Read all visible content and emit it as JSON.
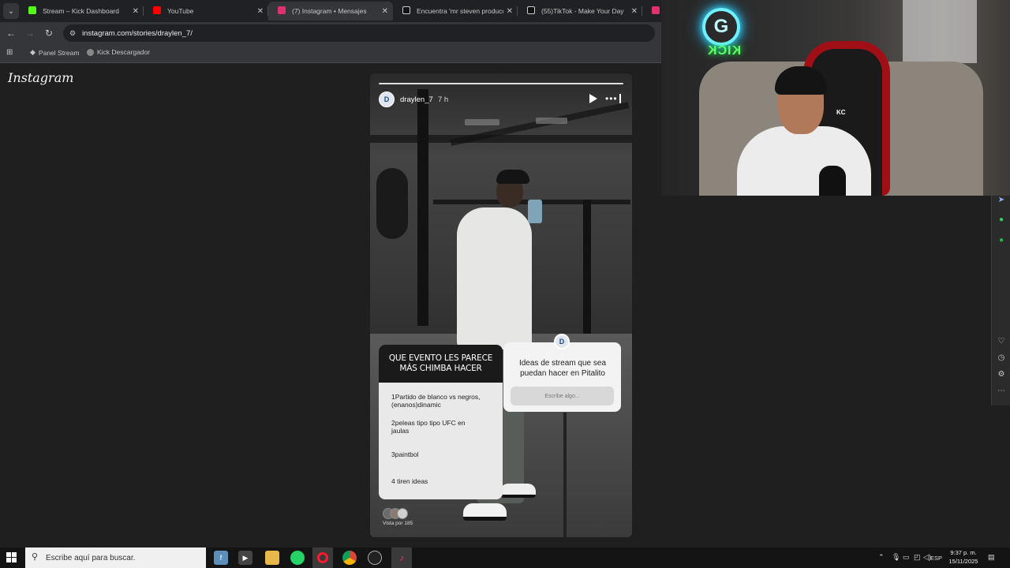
{
  "browser": {
    "tabs": [
      {
        "label": "Stream – Kick Dashboard",
        "icon": "kick-icon",
        "color": "#53fc18"
      },
      {
        "label": "YouTube",
        "icon": "youtube-icon",
        "color": "#ff0000"
      },
      {
        "label": "(7) Instagram • Mensajes",
        "icon": "instagram-icon",
        "color": "#e1306c"
      },
      {
        "label": "Encuentra 'mr steven produccio",
        "icon": "tiktok-icon",
        "color": "#ffffff"
      },
      {
        "label": "(55)TikTok - Make Your Day",
        "icon": "tiktok-icon",
        "color": "#ffffff"
      }
    ],
    "url": "instagram.com/stories/draylen_7/",
    "bookmarks": [
      {
        "label": "Panel Stream"
      },
      {
        "label": "Kick Descargador"
      }
    ]
  },
  "instagram": {
    "logo": "Instagram",
    "story": {
      "username": "draylen_7",
      "time": "7 h",
      "poll": {
        "title": "QUE EVENTO LES PARECE MÁS CHIMBA HACER",
        "options": [
          "1Partido de blanco vs negros,(enanos)dinamic",
          "2peleas tipo tipo UFC en jaulas",
          "3paintbol",
          "4 tiren ideas"
        ]
      },
      "question": {
        "text": "Ideas de stream que sea puedan hacer en Pitalito",
        "placeholder": "Escribe algo..."
      },
      "viewers_label": "Vista por 185"
    }
  },
  "webcam": {
    "badge": "KC"
  },
  "taskbar": {
    "search_placeholder": "Escribe aquí para buscar.",
    "language": "ESP",
    "time": "9:37 p. m.",
    "date": "15/11/2025"
  },
  "colors": {
    "kick_green": "#53fc18",
    "neon_blue": "#6ef0ff",
    "chair_red": "#a10f16"
  }
}
